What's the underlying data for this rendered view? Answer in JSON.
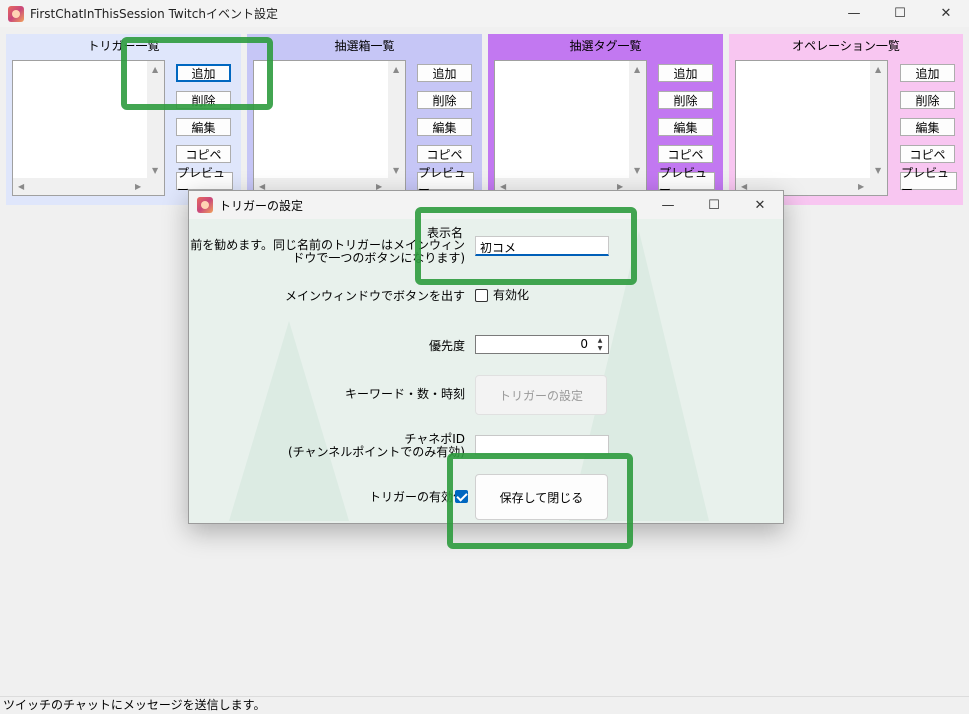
{
  "window": {
    "title": "FirstChatInThisSession Twitchイベント設定"
  },
  "window_controls": {
    "minimize": "—",
    "maximize": "☐",
    "close": "✕"
  },
  "panels": [
    {
      "title": "トリガー一覧",
      "bg": "#dfe6fb"
    },
    {
      "title": "抽選箱一覧",
      "bg": "#c6c6f6"
    },
    {
      "title": "抽選タグ一覧",
      "bg": "#c278f1"
    },
    {
      "title": "オペレーション一覧",
      "bg": "#f8c6f1"
    }
  ],
  "panel_buttons": {
    "add": "追加",
    "delete": "削除",
    "edit": "編集",
    "copy": "コピペ",
    "preview": "プレビュー"
  },
  "dialog": {
    "title": "トリガーの設定",
    "display_name_label": "表示名",
    "display_name_note_1": "(一意な名前を勧めます。同じ名前のトリガーはメインウィン",
    "display_name_note_2": "ドウで一つのボタンになります)",
    "display_name_value": "初コメ",
    "main_window_label": "メインウィンドウでボタンを出す",
    "main_window_check": "有効化",
    "priority_label": "優先度",
    "priority_value": "0",
    "keyword_label": "キーワード・数・時刻",
    "trigger_settings_button": "トリガーの設定",
    "channel_point_label_1": "チャネポID",
    "channel_point_label_2": "(チャンネルポイントでのみ有効)",
    "enable_trigger_label": "トリガーの有効化",
    "save_close_button": "保存して閉じる"
  },
  "status": {
    "text": "ツイッチのチャットにメッセージを送信します。"
  },
  "colors": {
    "accent": "#0067c0",
    "annotation_green": "#2e9b3e"
  }
}
